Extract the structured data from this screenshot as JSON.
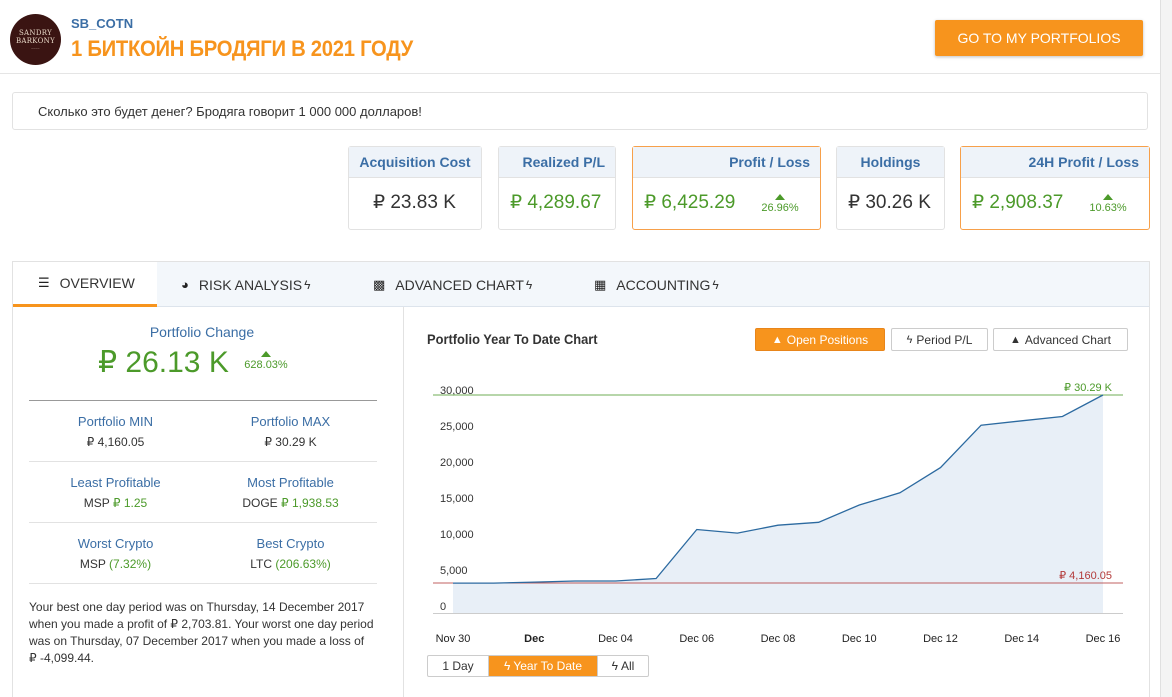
{
  "header": {
    "logo_line1": "SANDRY",
    "logo_line2": "BARKONY",
    "username": "SB_COTN",
    "title": "1 БИТКОЙН БРОДЯГИ В 2021 ГОДУ",
    "portfolios_button": "GO TO MY PORTFOLIOS"
  },
  "description": "Сколько это будет денег? Бродяга говорит 1 000 000 долларов!",
  "cards": {
    "acquisition_cost": {
      "label": "Acquisition Cost",
      "value": "₽ 23.83 K"
    },
    "realized_pl": {
      "label": "Realized P/L",
      "value": "₽ 4,289.67"
    },
    "profit_loss": {
      "label": "Profit / Loss",
      "value": "₽ 6,425.29",
      "pct": "26.96%"
    },
    "holdings": {
      "label": "Holdings",
      "value": "₽ 30.26 K"
    },
    "profit_24h": {
      "label": "24H Profit / Loss",
      "value": "₽ 2,908.37",
      "pct": "10.63%"
    }
  },
  "tabs": {
    "overview": "OVERVIEW",
    "risk": "RISK ANALYSIS",
    "advanced": "ADVANCED CHART",
    "accounting": "ACCOUNTING",
    "bolt": "ϟ"
  },
  "overview": {
    "change_label": "Portfolio Change",
    "change_value": "₽ 26.13 K",
    "change_pct": "628.03%",
    "min_label": "Portfolio MIN",
    "min_value": "₽ 4,160.05",
    "max_label": "Portfolio MAX",
    "max_value": "₽ 30.29 K",
    "least_label": "Least Profitable",
    "least_coin": "MSP",
    "least_value": "₽ 1.25",
    "most_label": "Most Profitable",
    "most_coin": "DOGE",
    "most_value": "₽ 1,938.53",
    "worst_label": "Worst Crypto",
    "worst_coin": "MSP",
    "worst_value": "(7.32%)",
    "best_label": "Best Crypto",
    "best_coin": "LTC",
    "best_value": "(206.63%)",
    "note": "Your best one day period was on Thursday, 14 December 2017 when you made a profit of ₽ 2,703.81. Your worst one day period was on Thursday, 07 December 2017 when you made a loss of ₽ -4,099.44."
  },
  "chart_panel": {
    "title": "Portfolio Year To Date Chart",
    "btn_open": "Open Positions",
    "btn_period": "Period P/L",
    "btn_advanced": "Advanced Chart",
    "range_1d": "1 Day",
    "range_ytd": "Year To Date",
    "range_all": "All"
  },
  "chart_data": {
    "type": "area",
    "x": [
      "Nov 30",
      "Dec 01",
      "Dec 02",
      "Dec 03",
      "Dec 04",
      "Dec 05",
      "Dec 06",
      "Dec 07",
      "Dec 08",
      "Dec 09",
      "Dec 10",
      "Dec 11",
      "Dec 12",
      "Dec 13",
      "Dec 14",
      "Dec 15",
      "Dec 16"
    ],
    "values": [
      4160,
      4160,
      4300,
      4450,
      4450,
      4800,
      11600,
      11100,
      12200,
      12600,
      15000,
      16700,
      20200,
      26100,
      26700,
      27300,
      30290
    ],
    "x_tick_labels": [
      "Nov 30",
      "Dec",
      "Dec 04",
      "Dec 06",
      "Dec 08",
      "Dec 10",
      "Dec 12",
      "Dec 14",
      "Dec 16"
    ],
    "x_tick_bold": [
      "Dec"
    ],
    "y_ticks": [
      0,
      5000,
      10000,
      15000,
      20000,
      25000,
      30000
    ],
    "y_tick_labels": [
      "0",
      "5,000",
      "10,000",
      "15,000",
      "20,000",
      "25,000",
      "30,000"
    ],
    "ylim": [
      0,
      30290
    ],
    "max_line": {
      "value": 30290,
      "label": "₽ 30.29 K",
      "color": "#4c9a2a"
    },
    "min_line": {
      "value": 4160.05,
      "label": "₽ 4,160.05",
      "color": "#b33a3a"
    },
    "line_color": "#2c6aa0",
    "fill_color": "#e8eff7",
    "grid": false,
    "title": "",
    "xlabel": "",
    "ylabel": ""
  },
  "colors": {
    "accent": "#f7941d",
    "brand_blue": "#3b6ea5",
    "positive": "#4c9a2a",
    "negative": "#b33a3a"
  }
}
